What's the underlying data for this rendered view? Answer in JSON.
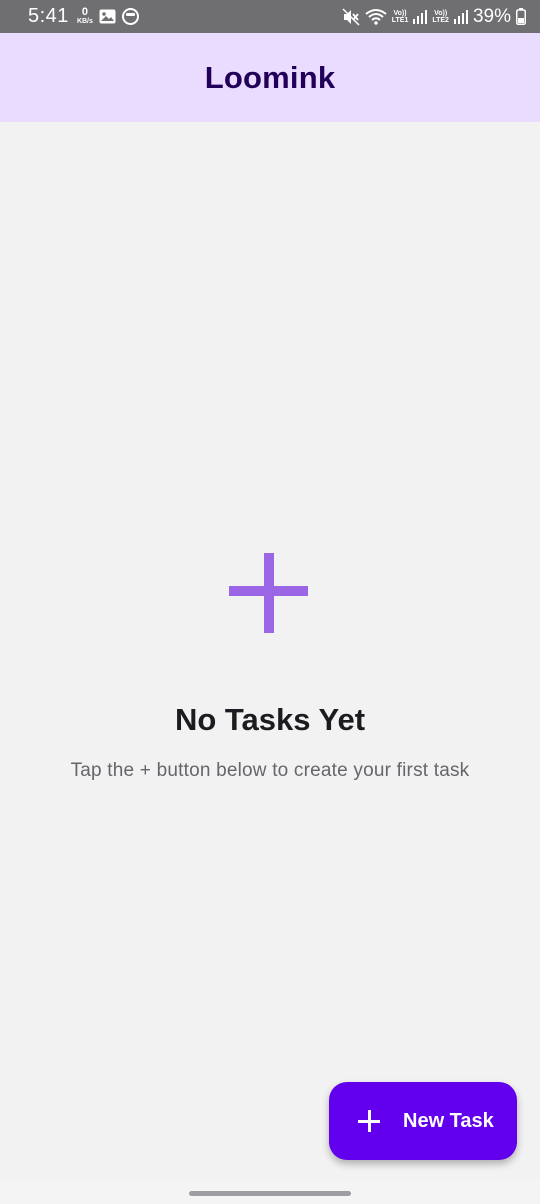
{
  "status_bar": {
    "time": "5:41",
    "net_speed_value": "0",
    "net_speed_unit": "KB/s",
    "sim1_label_top": "Vo))",
    "sim1_label_bottom": "LTE1",
    "sim2_label_top": "Vo))",
    "sim2_label_bottom": "LTE2",
    "battery_percent": "39%",
    "icons": [
      "gallery-icon",
      "app-notification-icon",
      "mute-icon",
      "wifi-icon",
      "signal-icon",
      "battery-icon"
    ]
  },
  "app_bar": {
    "title": "Loomink"
  },
  "empty_state": {
    "icon": "plus-icon",
    "title": "No Tasks Yet",
    "subtitle": "Tap the + button below to create your first task"
  },
  "fab": {
    "icon": "plus-icon",
    "label": "New Task"
  },
  "colors": {
    "app_bar_bg": "#eadcff",
    "title_color": "#22005a",
    "accent": "#6200ee",
    "empty_icon": "#9a66e6",
    "background": "#f2f2f3"
  }
}
